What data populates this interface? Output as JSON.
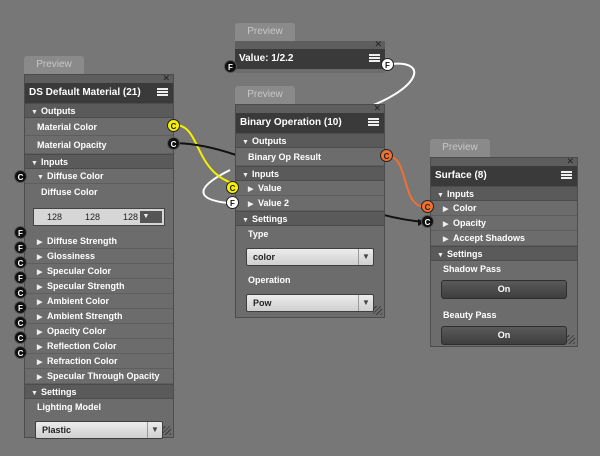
{
  "colors": {
    "background": "#777777",
    "title": "#3a3a3a",
    "port_yellow": "#f5f000",
    "port_orange": "#f07030",
    "port_black": "#111111"
  },
  "node_value": {
    "tab": "Preview",
    "title": "Value: 1/2.2",
    "port_in": "F",
    "port_out": "F"
  },
  "node_material": {
    "tab": "Preview",
    "title": "DS Default Material (21)",
    "outputs_label": "Outputs",
    "outputs": [
      {
        "label": "Material Color",
        "port": "C"
      },
      {
        "label": "Material Opacity",
        "port": "C"
      }
    ],
    "inputs_label": "Inputs",
    "diffuse_color": {
      "label": "Diffuse Color",
      "port": "C",
      "sublabel": "Diffuse Color",
      "r": "128",
      "g": "128",
      "b": "128"
    },
    "inputs": [
      {
        "label": "Diffuse Strength",
        "port": "F"
      },
      {
        "label": "Glossiness",
        "port": "F"
      },
      {
        "label": "Specular Color",
        "port": "C"
      },
      {
        "label": "Specular Strength",
        "port": "F"
      },
      {
        "label": "Ambient Color",
        "port": "C"
      },
      {
        "label": "Ambient Strength",
        "port": "F"
      },
      {
        "label": "Opacity Color",
        "port": "C"
      },
      {
        "label": "Reflection Color",
        "port": "C"
      },
      {
        "label": "Refraction Color",
        "port": "C"
      },
      {
        "label": "Specular Through Opacity",
        "port": ""
      }
    ],
    "settings_label": "Settings",
    "lighting_model_label": "Lighting Model",
    "lighting_model_value": "Plastic"
  },
  "node_binary": {
    "tab": "Preview",
    "title": "Binary Operation (10)",
    "outputs_label": "Outputs",
    "output": "Binary Op Result",
    "output_port": "C",
    "inputs_label": "Inputs",
    "inputs": [
      {
        "label": "Value",
        "port": "C"
      },
      {
        "label": "Value 2",
        "port": "F"
      }
    ],
    "settings_label": "Settings",
    "type_label": "Type",
    "type_value": "color",
    "operation_label": "Operation",
    "operation_value": "Pow"
  },
  "node_surface": {
    "tab": "Preview",
    "title": "Surface (8)",
    "inputs_label": "Inputs",
    "inputs": [
      {
        "label": "Color",
        "port": "C"
      },
      {
        "label": "Opacity",
        "port": "C"
      },
      {
        "label": "Accept Shadows",
        "port": ""
      }
    ],
    "settings_label": "Settings",
    "shadow_pass_label": "Shadow Pass",
    "shadow_pass_value": "On",
    "beauty_pass_label": "Beauty Pass",
    "beauty_pass_value": "On"
  },
  "icons": [
    "close-icon",
    "menu-icon",
    "expand-arrow-icon",
    "collapse-arrow-icon",
    "dropdown-arrow-icon",
    "resize-grip-icon"
  ]
}
